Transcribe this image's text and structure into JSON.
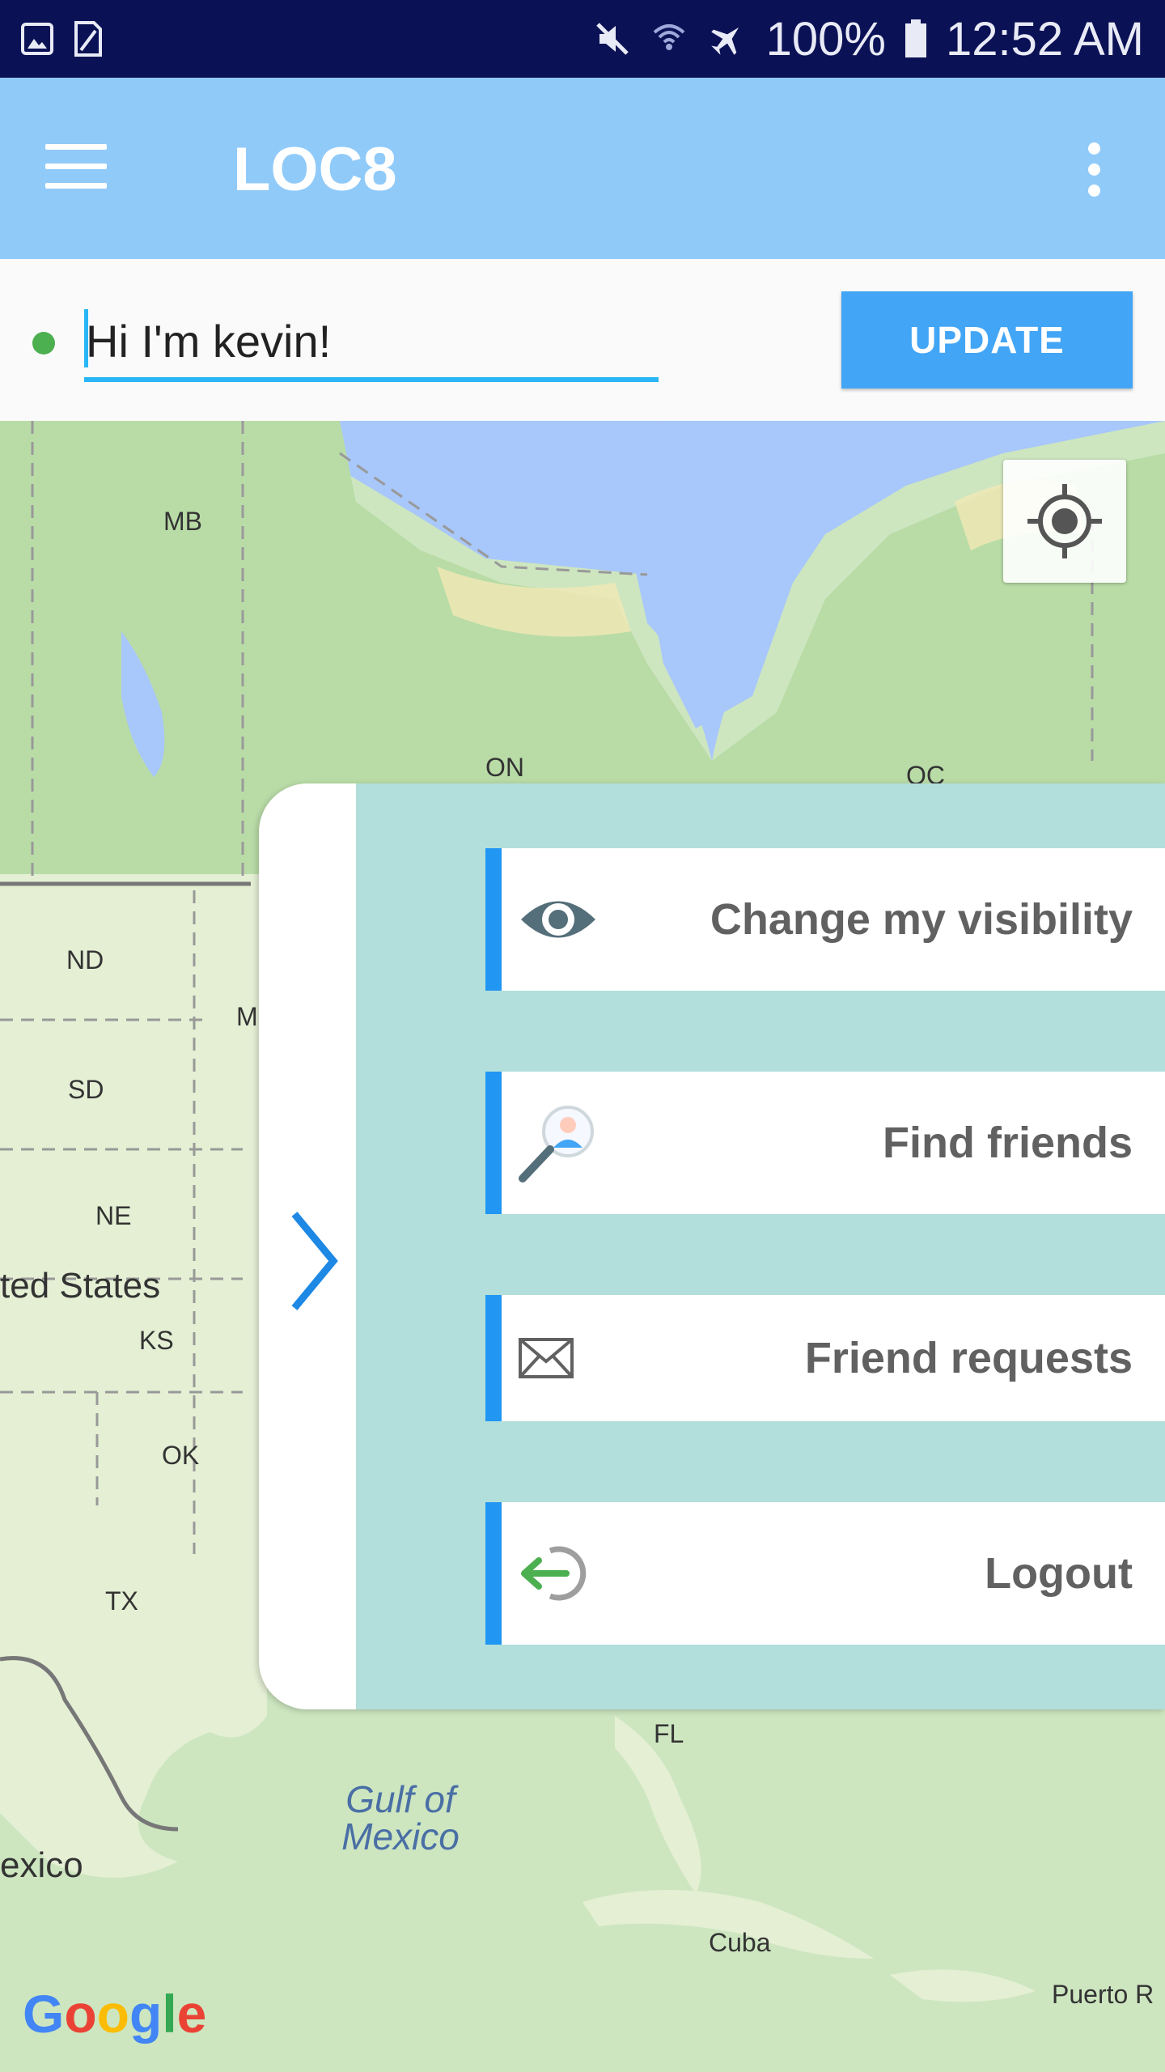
{
  "status_bar": {
    "battery": "100%",
    "time": "12:52 AM",
    "icons": [
      "image-icon",
      "sim-icon",
      "mute-icon",
      "wifi-icon",
      "airplane-icon",
      "battery-icon"
    ]
  },
  "app_bar": {
    "title": "LOC8",
    "icons": [
      "hamburger-menu-icon",
      "overflow-menu-icon"
    ]
  },
  "status_update": {
    "value": "Hi I'm kevin!",
    "button_label": "UPDATE",
    "online_color": "#4caf50"
  },
  "map": {
    "labels": {
      "mb": "MB",
      "on": "ON",
      "qc": "QC",
      "nd": "ND",
      "mn": "M",
      "sd": "SD",
      "ne": "NE",
      "us": "ted States",
      "ks": "KS",
      "ok": "OK",
      "tx": "TX",
      "fl": "FL",
      "gulf": "Gulf of Mexico",
      "mexico": "exico",
      "cuba": "Cuba",
      "pr": "Puerto R"
    },
    "attribution": "Google",
    "locate_icon": "my-location-icon"
  },
  "side_menu": {
    "items": [
      {
        "label": "Change my visibility",
        "icon": "eye-icon"
      },
      {
        "label": "Find friends",
        "icon": "find-friends-icon"
      },
      {
        "label": "Friend requests",
        "icon": "envelope-icon"
      },
      {
        "label": "Logout",
        "icon": "logout-icon"
      }
    ],
    "accent": "#2196f3",
    "panel_color": "#b2dfdb"
  }
}
